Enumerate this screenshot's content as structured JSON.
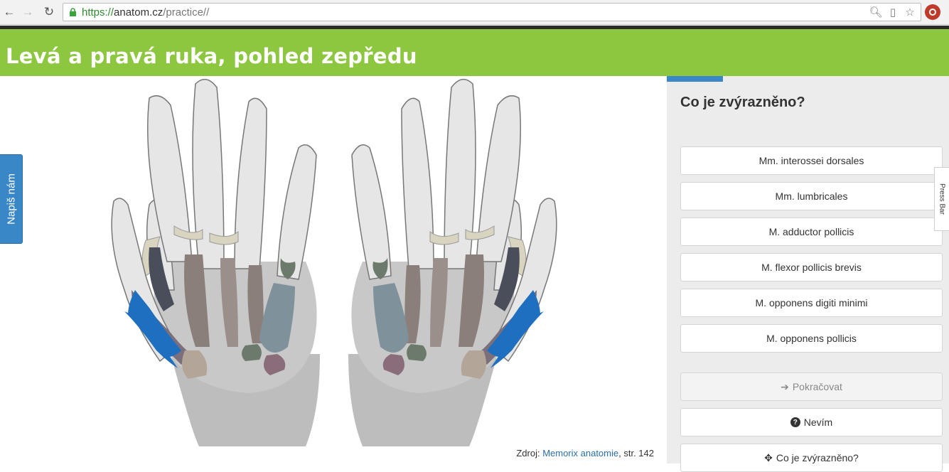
{
  "browser": {
    "url_scheme": "https://",
    "url_host": "anatom.cz",
    "url_path": "/practice//"
  },
  "header": {
    "title": "Levá a pravá ruka, pohled zepředu"
  },
  "feedback": {
    "label": "Napiš nám"
  },
  "figure": {
    "source_prefix": "Zdroj: ",
    "source_link": "Memorix anatomie",
    "source_suffix": ", str. 142"
  },
  "panel": {
    "progress": 0.2,
    "question": "Co je zvýrazněno?",
    "options": [
      "Mm. interossei dorsales",
      "Mm. lumbricales",
      "M. adductor pollicis",
      "M. flexor pollicis brevis",
      "M. opponens digiti minimi",
      "M. opponens pollicis"
    ],
    "continue_label": "Pokračovat",
    "dont_know_label": "Nevím",
    "highlight_label": "Co je zvýrazněno?"
  },
  "pressbar": {
    "label": "Press Bar"
  },
  "colors": {
    "header_green": "#8dc63f",
    "accent_blue": "#3a87c8",
    "highlight_muscle": "#1f6fc0"
  }
}
